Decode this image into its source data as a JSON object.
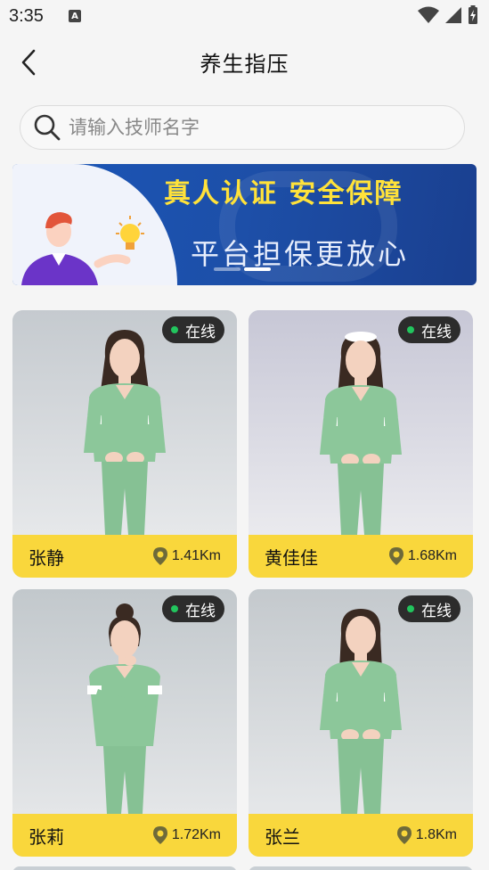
{
  "status_bar": {
    "time": "3:35",
    "a_icon_text": "A"
  },
  "header": {
    "title": "养生指压"
  },
  "search": {
    "placeholder": "请输入技师名字"
  },
  "banner": {
    "line1": "真人认证  安全保障",
    "line2": "平台担保更放心",
    "slide_count": 2,
    "active_slide": 2
  },
  "cards": [
    {
      "name": "张静",
      "status": "在线",
      "distance": "1.41Km",
      "hair_style": "long"
    },
    {
      "name": "黄佳佳",
      "status": "在线",
      "distance": "1.68Km",
      "hair_style": "cap"
    },
    {
      "name": "张莉",
      "status": "在线",
      "distance": "1.72Km",
      "hair_style": "bun"
    },
    {
      "name": "张兰",
      "status": "在线",
      "distance": "1.8Km",
      "hair_style": "long"
    }
  ],
  "colors": {
    "accent_yellow": "#f9d73c",
    "online_green": "#22c55e",
    "banner_blue": "#1a56b8",
    "uniform_green": "#8cc79a"
  }
}
